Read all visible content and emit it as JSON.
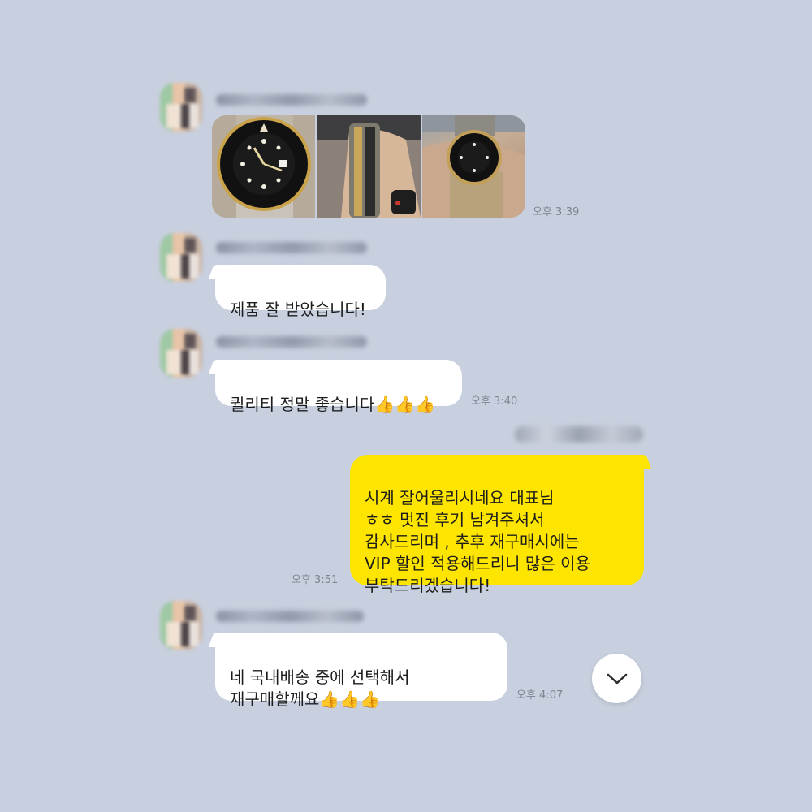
{
  "colors": {
    "background": "#c8d0df",
    "incoming_bubble": "#ffffff",
    "outgoing_bubble": "#fee500",
    "time_text": "#7d8593"
  },
  "messages": [
    {
      "id": "m1",
      "type": "photo_group",
      "direction": "incoming",
      "photos": [
        "watch-closeup-photo",
        "watch-on-wrist-side-photo",
        "watch-on-wrist-photo"
      ],
      "time": "오후 3:39"
    },
    {
      "id": "m2",
      "type": "text",
      "direction": "incoming",
      "text": "제품 잘 받았습니다!",
      "time": ""
    },
    {
      "id": "m3",
      "type": "text",
      "direction": "incoming",
      "text": "퀄리티 정말 좋습니다",
      "emoji": "👍👍👍",
      "time": "오후 3:40"
    },
    {
      "id": "m4",
      "type": "text",
      "direction": "outgoing",
      "text": "시계 잘어울리시네요 대표님\nㅎㅎ 멋진 후기 남겨주셔서\n감사드리며 , 추후 재구매시에는\nVIP 할인 적용해드리니 많은 이용\n부탁드리겠습니다!",
      "time": "오후 3:51"
    },
    {
      "id": "m5",
      "type": "text",
      "direction": "incoming",
      "text": "네 국내배송 중에 선택해서\n재구매할께요",
      "emoji": "👍👍👍",
      "time": "오후 4:07"
    }
  ],
  "scroll_button": {
    "icon": "chevron-down-icon"
  }
}
